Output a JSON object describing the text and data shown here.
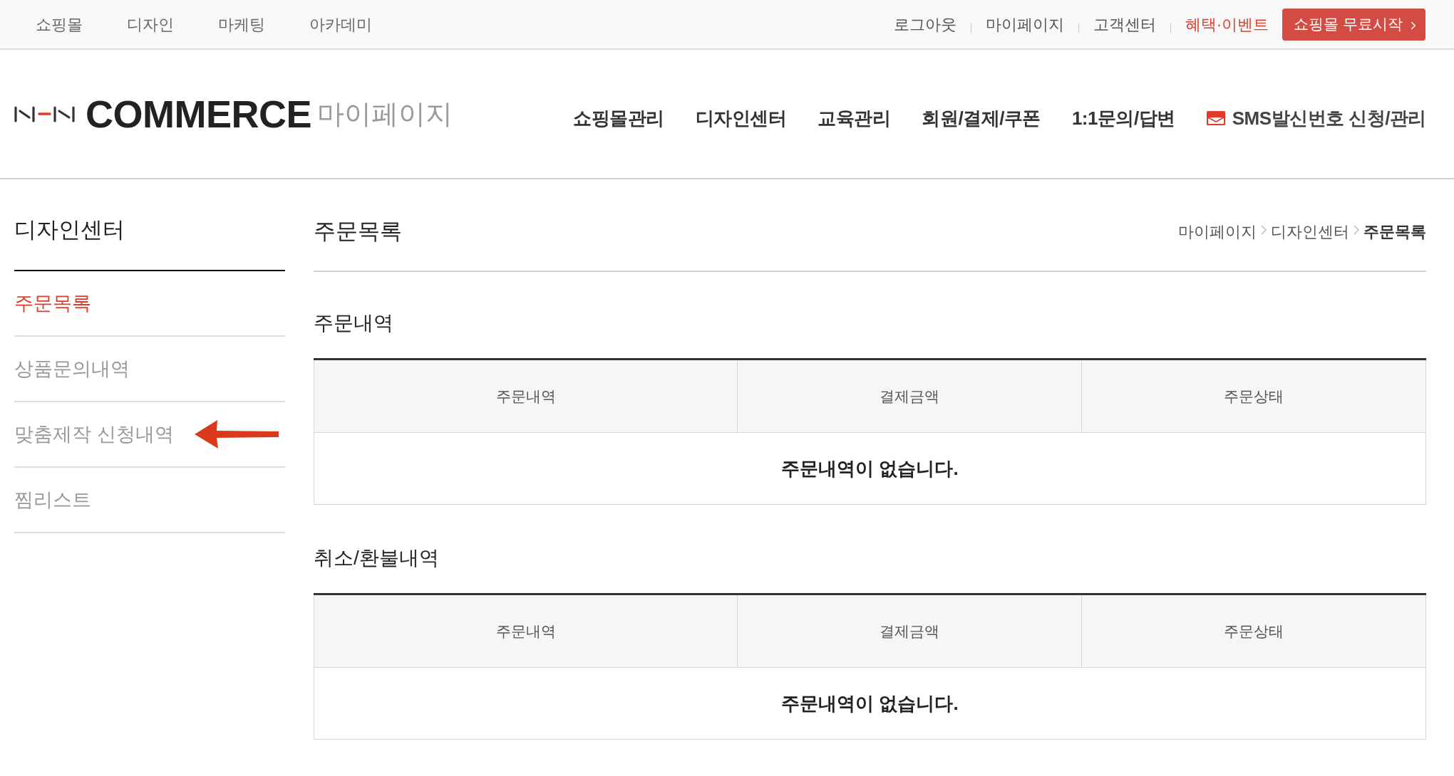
{
  "top_bar": {
    "left_links": [
      {
        "label": "쇼핑몰"
      },
      {
        "label": "디자인"
      },
      {
        "label": "마케팅"
      },
      {
        "label": "아카데미"
      }
    ],
    "right_links": [
      {
        "label": "로그아웃",
        "highlighted": false
      },
      {
        "label": "마이페이지",
        "highlighted": false
      },
      {
        "label": "고객센터",
        "highlighted": false
      },
      {
        "label": "혜택·이벤트",
        "highlighted": true
      }
    ],
    "cta_button": {
      "label": "쇼핑몰 무료시작"
    }
  },
  "header": {
    "logo": {
      "text": "COMMERCE",
      "subtitle": "마이페이지"
    },
    "nav": [
      {
        "label": "쇼핑몰관리",
        "kind": "plain"
      },
      {
        "label": "디자인센터",
        "kind": "plain"
      },
      {
        "label": "교육관리",
        "kind": "plain"
      },
      {
        "label": "회원/결제/쿠폰",
        "kind": "plain"
      },
      {
        "label": "1:1문의/답변",
        "kind": "plain"
      },
      {
        "label": "SMS발신번호 신청/관리",
        "kind": "envelope"
      }
    ]
  },
  "sidebar": {
    "title": "디자인센터",
    "items": [
      {
        "label": "주문목록",
        "selected": true,
        "arrow": false
      },
      {
        "label": "상품문의내역",
        "selected": false,
        "arrow": false
      },
      {
        "label": "맞춤제작 신청내역",
        "selected": false,
        "arrow": true
      },
      {
        "label": "찜리스트",
        "selected": false,
        "arrow": false
      }
    ]
  },
  "main": {
    "title": "주문목록",
    "breadcrumb": [
      {
        "label": "마이페이지",
        "current": false
      },
      {
        "label": "디자인센터",
        "current": false
      },
      {
        "label": "주문목록",
        "current": true
      }
    ],
    "sections": [
      {
        "heading": "주문내역",
        "table": {
          "columns": [
            "주문내역",
            "결제금액",
            "주문상태"
          ],
          "empty_message": "주문내역이 없습니다."
        }
      },
      {
        "heading": "취소/환불내역",
        "table": {
          "columns": [
            "주문내역",
            "결제금액",
            "주문상태"
          ],
          "empty_message": "주문내역이 없습니다."
        }
      }
    ]
  }
}
